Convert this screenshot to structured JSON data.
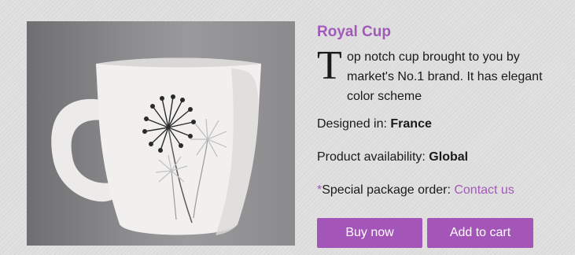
{
  "product": {
    "title": "Royal Cup",
    "dropcap": "T",
    "description": "op notch cup brought to you by market's No.1 brand. It has elegant color scheme",
    "designed_label": "Designed in: ",
    "designed_value": "France",
    "availability_label": "Product availability: ",
    "availability_value": "Global",
    "special_marker": "*",
    "special_label": "Special package order: ",
    "special_link": "Contact us"
  },
  "actions": {
    "buy_label": "Buy now",
    "cart_label": "Add to cart"
  },
  "colors": {
    "accent": "#a15ab8",
    "button": "#a456b8",
    "background": "#dedede"
  }
}
